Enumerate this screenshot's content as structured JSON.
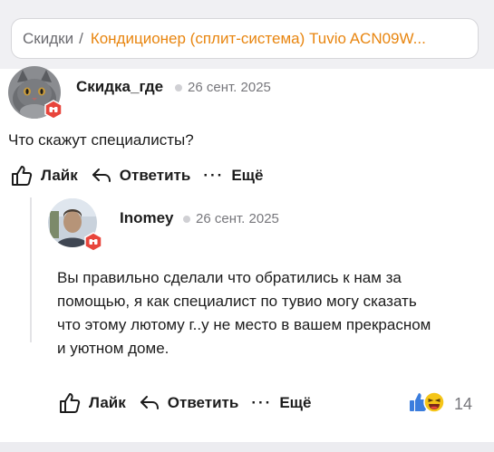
{
  "breadcrumb": {
    "root": "Скидки",
    "separator": "/",
    "current": "Кондиционер (сплит-система) Tuvio ACN09W..."
  },
  "comments": [
    {
      "author": "Скидка_где",
      "date": "26 сент. 2025",
      "text": "Что скажут специалисты?",
      "actions": {
        "like": "Лайк",
        "reply": "Ответить",
        "more_dots": "···",
        "more": "Ещё"
      }
    },
    {
      "author": "Inomey",
      "date": "26 сент. 2025",
      "text_lines": [
        "Вы правильно сделали что обратились к нам за",
        "помощью, я как специалист по тувио могу сказать",
        "что этому лютому г..у не место в вашем прекрасном",
        "и уютном доме."
      ],
      "actions": {
        "like": "Лайк",
        "reply": "Ответить",
        "more_dots": "···",
        "more": "Ещё"
      },
      "reactions": {
        "icons": [
          "thumbs-up-emoji",
          "laughing-emoji"
        ],
        "count": "14"
      }
    }
  ],
  "colors": {
    "accent": "#e8850f",
    "badge": "#e8453c",
    "reaction_like": "#3b7ddd",
    "reaction_laugh": "#f5c518"
  }
}
